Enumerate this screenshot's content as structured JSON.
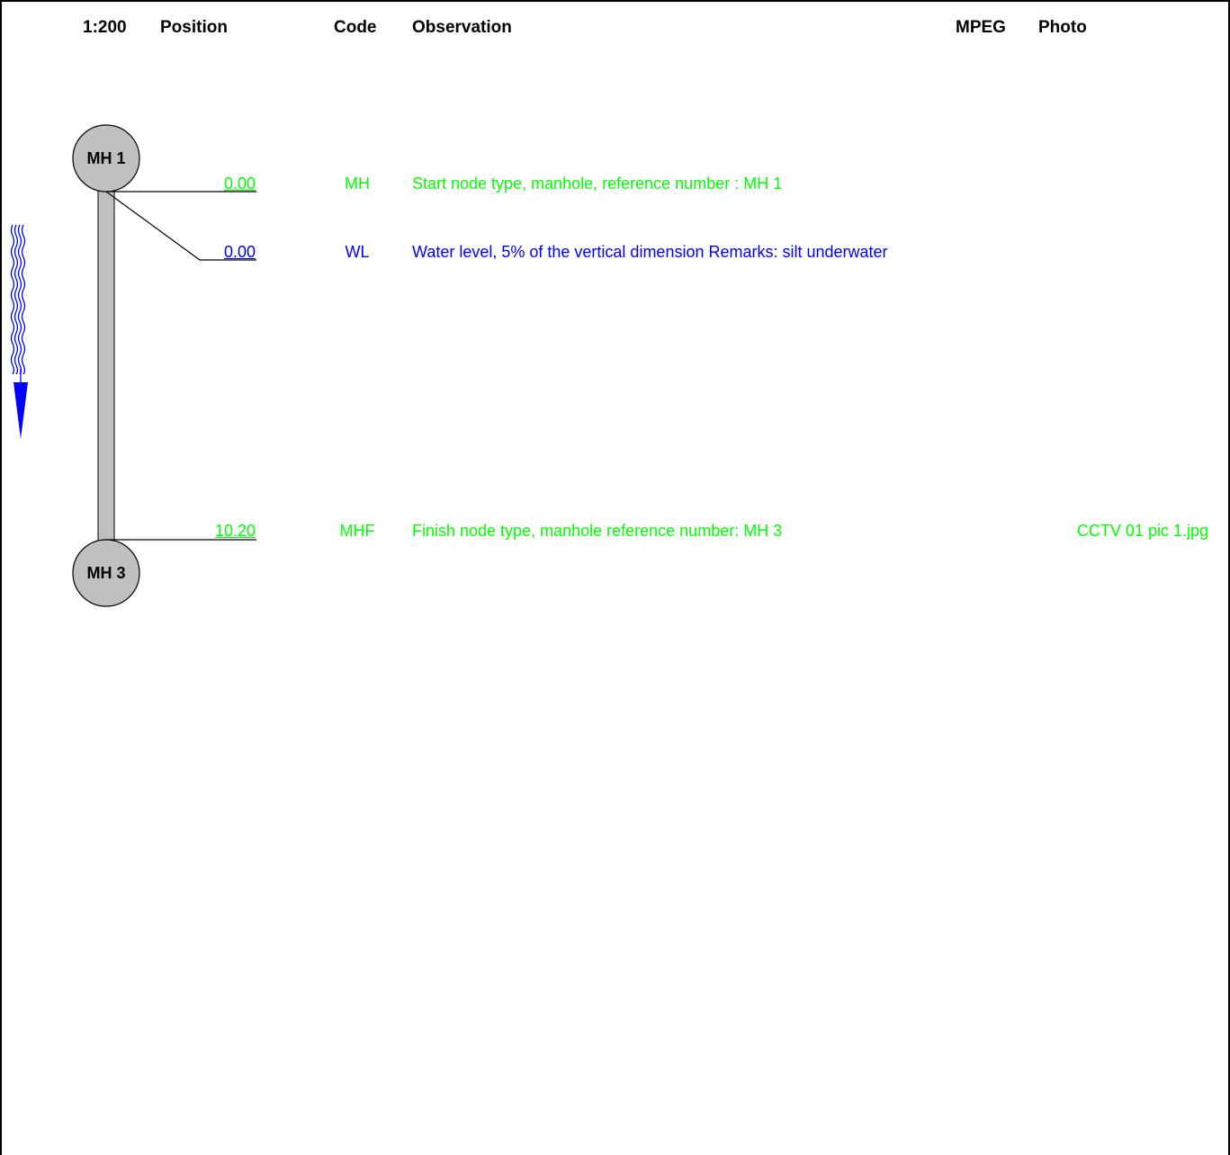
{
  "header": {
    "scale": "1:200",
    "position": "Position",
    "code": "Code",
    "observation": "Observation",
    "mpeg": "MPEG",
    "photo": "Photo"
  },
  "nodes": {
    "start": "MH 1",
    "finish": "MH 3"
  },
  "observations": [
    {
      "position": "0.00",
      "code": "MH",
      "text": "Start node type, manhole, reference number : MH 1",
      "photo": ""
    },
    {
      "position": "0.00",
      "code": "WL",
      "text": "Water level, 5% of the vertical dimension Remarks: silt underwater",
      "photo": ""
    },
    {
      "position": "10.20",
      "code": "MHF",
      "text": "Finish node type, manhole reference number: MH 3",
      "photo": "CCTV 01 pic 1.jpg"
    }
  ],
  "colors": {
    "green": "#00ff00",
    "blue": "#0000ff",
    "pipe": "#c0c0c0",
    "manhole": "#c0c0c0",
    "border": "#000000"
  }
}
